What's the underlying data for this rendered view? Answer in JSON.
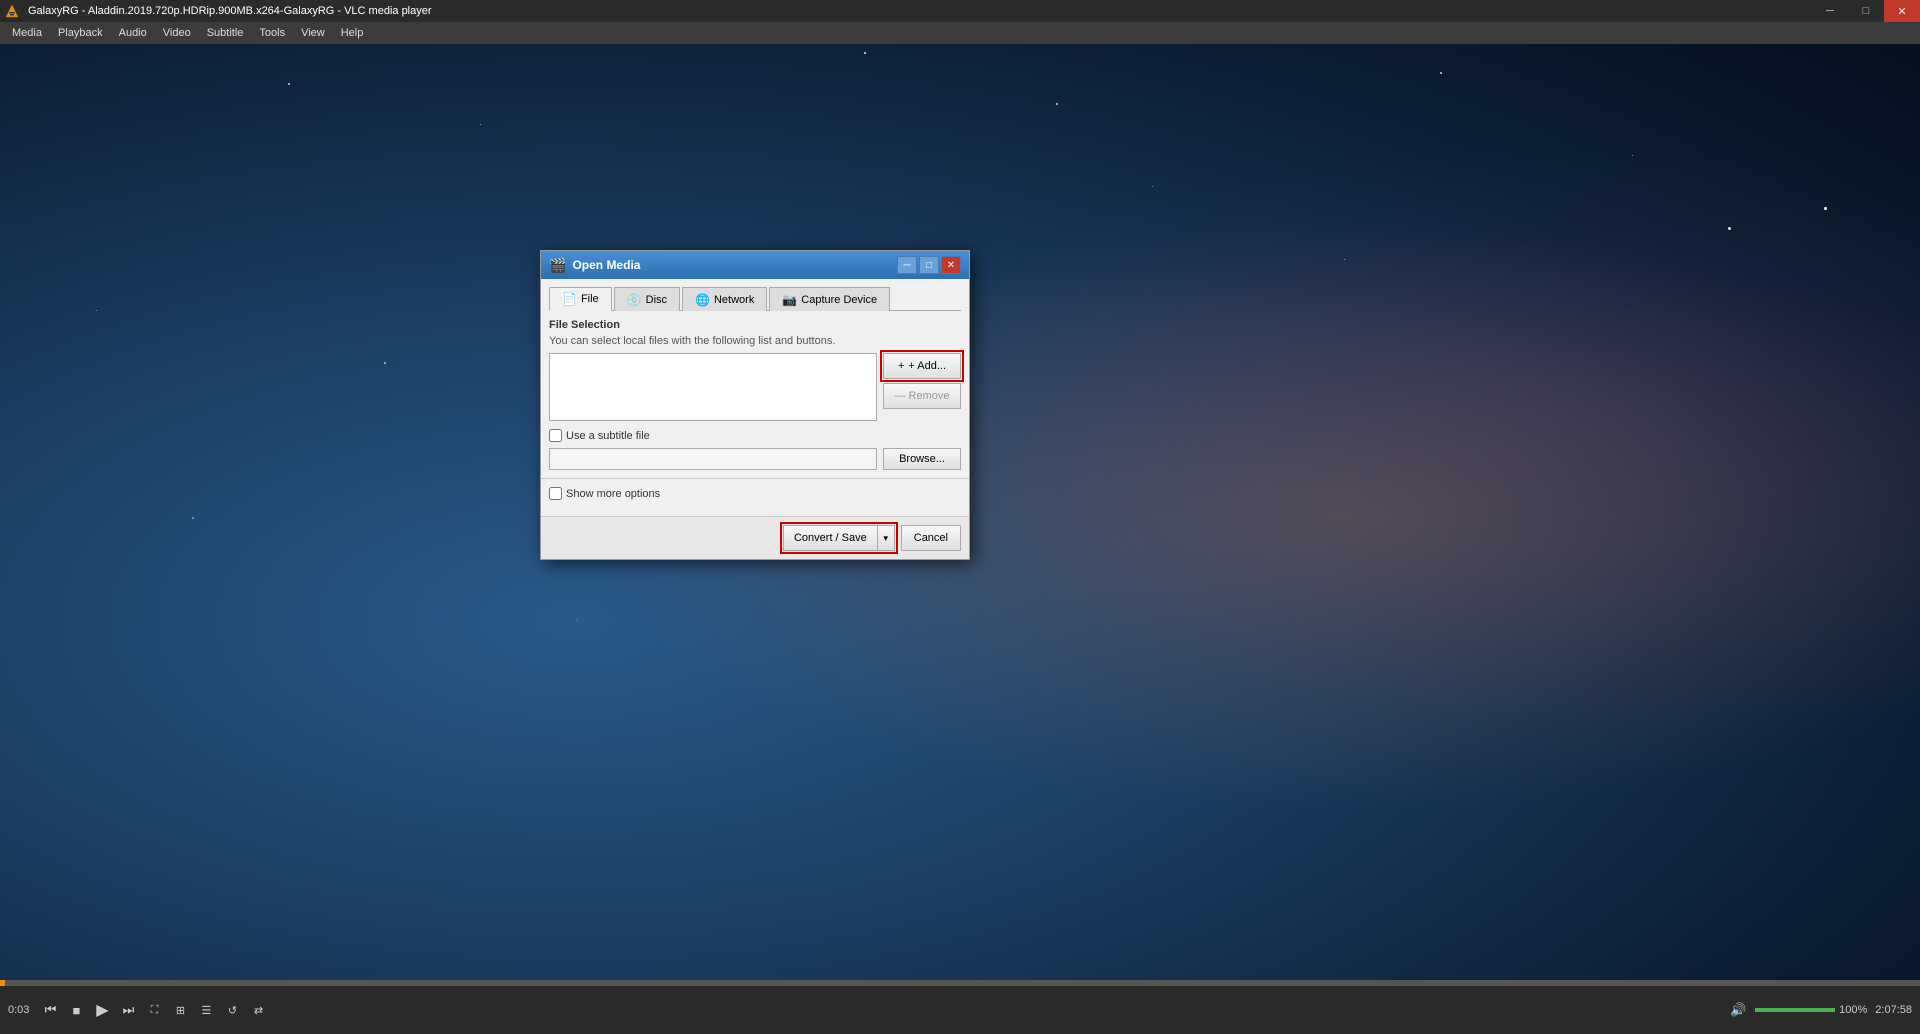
{
  "app": {
    "title": "GalaxyRG - Aladdin.2019.720p.HDRip.900MB.x264-GalaxyRG - VLC media player"
  },
  "titlebar": {
    "minimize_label": "─",
    "restore_label": "□",
    "close_label": "✕"
  },
  "menubar": {
    "items": [
      "Media",
      "Playback",
      "Audio",
      "Video",
      "Subtitle",
      "Tools",
      "View",
      "Help"
    ]
  },
  "bottombar": {
    "time_elapsed": "0:03",
    "time_remaining": "2:07:58",
    "volume": "100%"
  },
  "dialog": {
    "title": "Open Media",
    "tabs": [
      {
        "id": "file",
        "label": "File",
        "icon": "📄",
        "active": true
      },
      {
        "id": "disc",
        "label": "Disc",
        "icon": "💿"
      },
      {
        "id": "network",
        "label": "Network",
        "icon": "🌐"
      },
      {
        "id": "capture",
        "label": "Capture Device",
        "icon": "📷"
      }
    ],
    "file_selection": {
      "section_title": "File Selection",
      "description": "You can select local files with the following list and buttons.",
      "add_label": "+ Add...",
      "remove_label": "— Remove"
    },
    "subtitle": {
      "checkbox_label": "Use a subtitle file",
      "browse_label": "Browse..."
    },
    "options": {
      "checkbox_label": "Show more options"
    },
    "footer": {
      "convert_label": "Convert / Save",
      "convert_arrow": "▾",
      "cancel_label": "Cancel"
    }
  }
}
